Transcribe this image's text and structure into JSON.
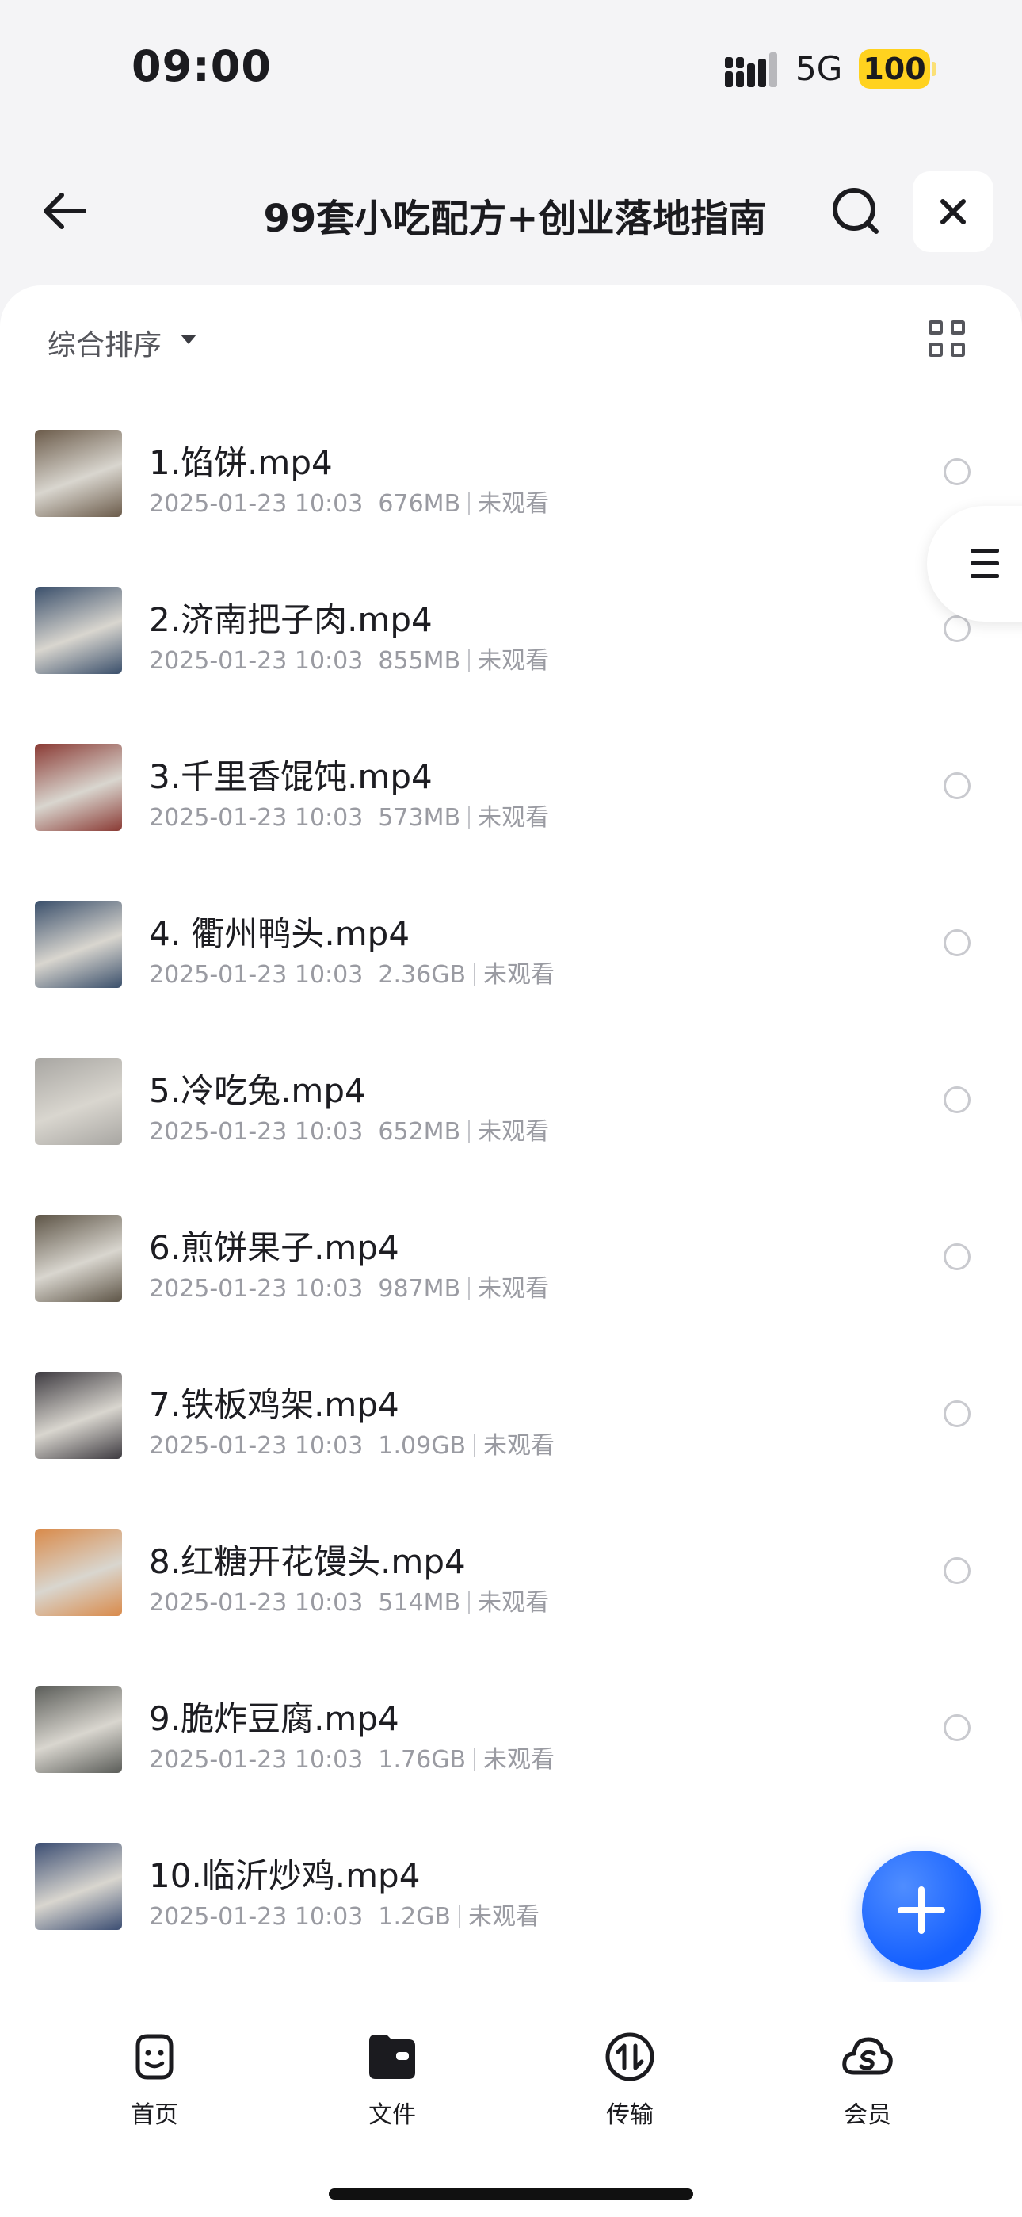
{
  "status": {
    "time": "09:00",
    "network": "5G",
    "battery": "100"
  },
  "header": {
    "title": "99套小吃配方+创业落地指南"
  },
  "toolbar": {
    "sort_label": "综合排序"
  },
  "files": [
    {
      "name": "1.馅饼.mp4",
      "date": "2025-01-23 10:03",
      "size": "676MB",
      "status": "未观看",
      "thumb_color": "#6b5b4a"
    },
    {
      "name": "2.济南把子肉.mp4",
      "date": "2025-01-23 10:03",
      "size": "855MB",
      "status": "未观看",
      "thumb_color": "#3a4f6b"
    },
    {
      "name": "3.千里香馄饨.mp4",
      "date": "2025-01-23 10:03",
      "size": "573MB",
      "status": "未观看",
      "thumb_color": "#8a3a34"
    },
    {
      "name": "4. 衢州鸭头.mp4",
      "date": "2025-01-23 10:03",
      "size": "2.36GB",
      "status": "未观看",
      "thumb_color": "#3a4f6b"
    },
    {
      "name": "5.冷吃兔.mp4",
      "date": "2025-01-23 10:03",
      "size": "652MB",
      "status": "未观看",
      "thumb_color": "#a8a6a2"
    },
    {
      "name": "6.煎饼果子.mp4",
      "date": "2025-01-23 10:03",
      "size": "987MB",
      "status": "未观看",
      "thumb_color": "#5d5446"
    },
    {
      "name": "7.铁板鸡架.mp4",
      "date": "2025-01-23 10:03",
      "size": "1.09GB",
      "status": "未观看",
      "thumb_color": "#3d3a40"
    },
    {
      "name": "8.红糖开花馒头.mp4",
      "date": "2025-01-23 10:03",
      "size": "514MB",
      "status": "未观看",
      "thumb_color": "#d98a4a"
    },
    {
      "name": "9.脆炸豆腐.mp4",
      "date": "2025-01-23 10:03",
      "size": "1.76GB",
      "status": "未观看",
      "thumb_color": "#5a5c58"
    },
    {
      "name": "10.临沂炒鸡.mp4",
      "date": "2025-01-23 10:03",
      "size": "1.2GB",
      "status": "未观看",
      "thumb_color": "#3b4d72"
    }
  ],
  "tabs": [
    {
      "label": "首页",
      "icon": "smile-face-icon"
    },
    {
      "label": "文件",
      "icon": "folder-icon"
    },
    {
      "label": "传输",
      "icon": "transfer-icon"
    },
    {
      "label": "会员",
      "icon": "cloud-s-icon"
    }
  ]
}
